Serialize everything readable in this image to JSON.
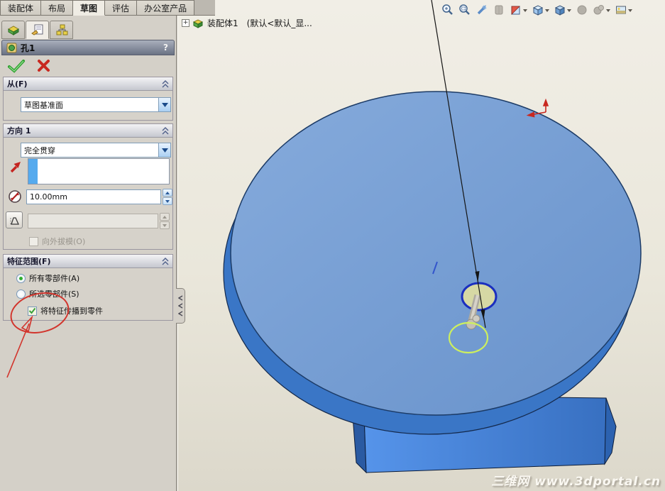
{
  "command_tabs": [
    {
      "label": "装配体",
      "active": false
    },
    {
      "label": "布局",
      "active": false
    },
    {
      "label": "草图",
      "active": true
    },
    {
      "label": "评估",
      "active": false
    },
    {
      "label": "办公室产品",
      "active": false
    }
  ],
  "panel": {
    "title": "孔1",
    "help": "?",
    "tabs": [
      "feature-manager-tree",
      "property-manager",
      "configuration-manager"
    ],
    "from_group": {
      "header": "从(F)",
      "value": "草图基准面"
    },
    "direction_group": {
      "header": "方向 1",
      "end_condition": "完全贯穿",
      "diameter": "10.00mm",
      "draft_checkbox": "向外拔模(O)"
    },
    "scope_group": {
      "header": "特征范围(F)",
      "option_all": "所有零部件(A)",
      "option_selected": "所选零部件(S)",
      "propagate_checkbox": "将特征传播到零件"
    }
  },
  "feature_tree": {
    "expander": "+",
    "root_label": "装配体1　(默认<默认_显..."
  },
  "viewport": {
    "watermark": "三维网 www.3dportal.cn",
    "toolbar_icons": [
      "zoom-to-fit",
      "zoom-to-area",
      "previous-view",
      "pan",
      "section-view",
      "view-orientation",
      "display-style",
      "hide-show-items",
      "edit-appearance",
      "apply-scene"
    ]
  },
  "colors": {
    "part_top_blue": "#7aa2d6",
    "part_side_blue": "#3a76c6",
    "base_blue": "#4286d8",
    "selected_edge_blue": "#1b2fbf",
    "preview_edge_green": "#cdef5e",
    "hole_highlight_fill": "#d6d8a4",
    "annotation_red": "#d2342c",
    "selection_stripe_blue": "#55aaee"
  }
}
